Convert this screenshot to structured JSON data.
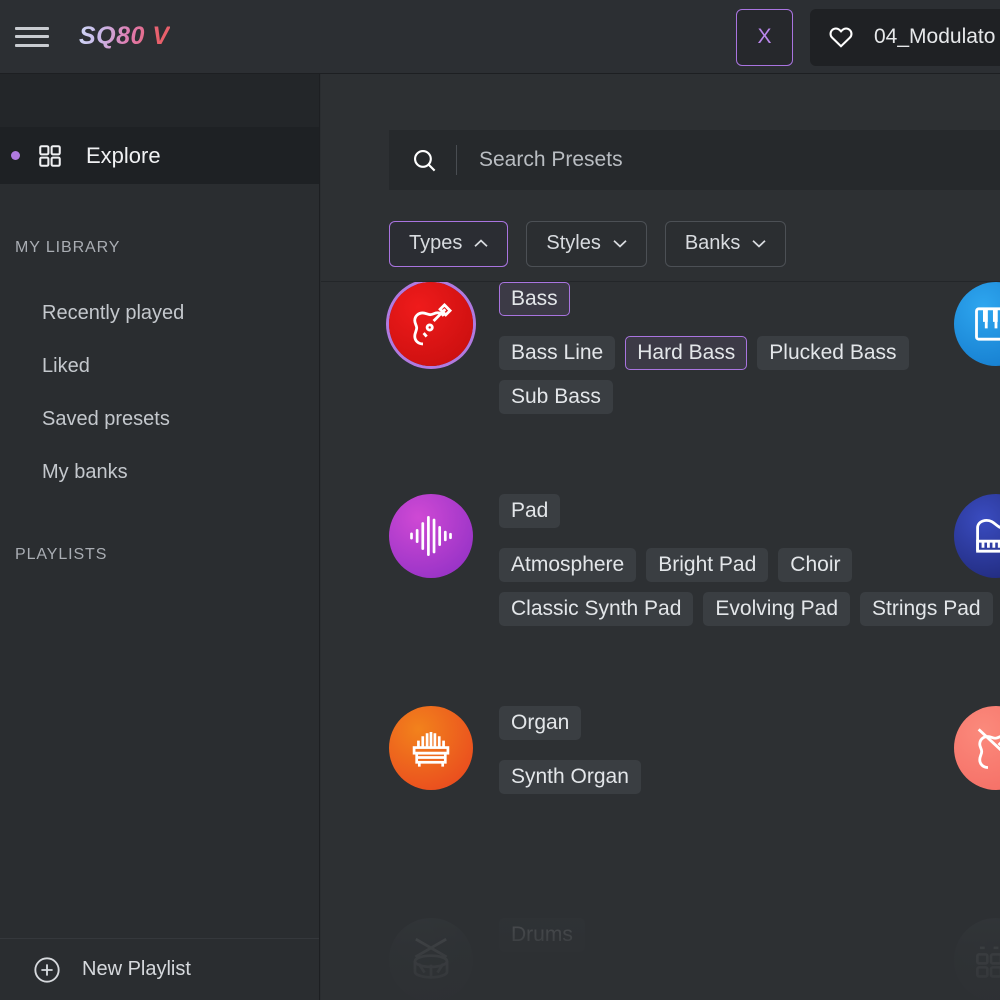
{
  "colors": {
    "accent_purple": "#a974e0",
    "header_bg": "#2c2f33",
    "sidebar_bg": "#2a2d30",
    "main_bg": "#2d3033",
    "tag_bg": "#3a3e42"
  },
  "header": {
    "menu_icon": "hamburger-icon",
    "brand": "SQ80 V",
    "close_label": "X",
    "like_icon": "heart-icon",
    "preset_name": "04_Modulato"
  },
  "sidebar": {
    "explore": {
      "label": "Explore",
      "icon": "grid-icon",
      "active": true
    },
    "library_heading": "MY LIBRARY",
    "library_items": [
      {
        "label": "Recently played"
      },
      {
        "label": "Liked"
      },
      {
        "label": "Saved presets"
      },
      {
        "label": "My banks"
      }
    ],
    "playlists_heading": "PLAYLISTS",
    "new_playlist": {
      "label": "New Playlist",
      "icon": "plus-circle-icon"
    }
  },
  "search": {
    "icon": "search-icon",
    "placeholder": "Search Presets",
    "value": ""
  },
  "filters": [
    {
      "label": "Types",
      "icon": "chevron-up-icon",
      "active": true
    },
    {
      "label": "Styles",
      "icon": "chevron-down-icon",
      "active": false
    },
    {
      "label": "Banks",
      "icon": "chevron-down-icon",
      "active": false
    }
  ],
  "type_rows": [
    {
      "id": "bass",
      "icon": "guitar-icon",
      "icon_color_a": "#ef1b1b",
      "icon_color_b": "#c40d0d",
      "icon_ring": true,
      "primary": {
        "label": "Bass",
        "selected": true
      },
      "subtags": [
        {
          "label": "Bass Line",
          "selected": false
        },
        {
          "label": "Hard Bass",
          "selected": true
        },
        {
          "label": "Plucked Bass",
          "selected": false
        },
        {
          "label": "Sub Bass",
          "selected": false
        }
      ],
      "right_icon": {
        "name": "piano-keys-icon",
        "color_a": "#2ea6ef",
        "color_b": "#1176c9"
      }
    },
    {
      "id": "pad",
      "icon": "waveform-icon",
      "icon_color_a": "#cf49d4",
      "icon_color_b": "#8b2ec4",
      "icon_ring": false,
      "primary": {
        "label": "Pad",
        "selected": false
      },
      "subtags": [
        {
          "label": "Atmosphere",
          "selected": false
        },
        {
          "label": "Bright Pad",
          "selected": false
        },
        {
          "label": "Choir",
          "selected": false
        },
        {
          "label": "Classic Synth Pad",
          "selected": false
        },
        {
          "label": "Evolving Pad",
          "selected": false
        },
        {
          "label": "Strings Pad",
          "selected": false
        }
      ],
      "right_icon": {
        "name": "grand-piano-icon",
        "color_a": "#3a4cc0",
        "color_b": "#1c2470"
      }
    },
    {
      "id": "organ",
      "icon": "organ-icon",
      "icon_color_a": "#f2821c",
      "icon_color_b": "#e8411f",
      "icon_ring": false,
      "primary": {
        "label": "Organ",
        "selected": false
      },
      "subtags": [
        {
          "label": "Synth Organ",
          "selected": false
        }
      ],
      "right_icon": {
        "name": "violin-icon",
        "color_a": "#fb8a7c",
        "color_b": "#f46a62"
      }
    },
    {
      "id": "drums",
      "icon": "drum-icon",
      "icon_color_a": "#3f4448",
      "icon_color_b": "#353a3e",
      "icon_ring": false,
      "primary": {
        "label": "Drums",
        "selected": false
      },
      "subtags": [],
      "right_icon": {
        "name": "drum-pads-icon",
        "color_a": "#4a5054",
        "color_b": "#3d4347"
      }
    }
  ]
}
